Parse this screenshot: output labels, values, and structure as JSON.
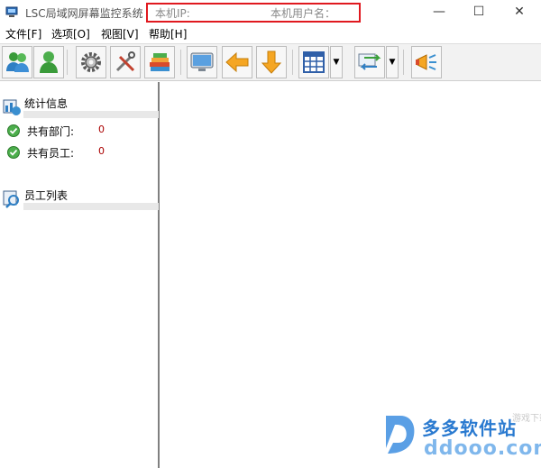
{
  "window": {
    "title": "LSC局域网屏幕监控系统",
    "ip_label": "本机IP:",
    "user_label": "本机用户名：",
    "highlight_color": "#e0191f",
    "minimize_symbol": "—",
    "maximize_symbol": "☐",
    "close_symbol": "✕"
  },
  "menu": {
    "file": "文件[F]",
    "options": "选项[O]",
    "view": "视图[V]",
    "help": "帮助[H]"
  },
  "toolbar": {
    "buttons": [
      {
        "icon": "users-icon"
      },
      {
        "icon": "user-icon"
      },
      {
        "icon": "gear-icon"
      },
      {
        "icon": "tools-icon"
      },
      {
        "icon": "books-icon"
      },
      {
        "icon": "monitor-icon"
      },
      {
        "icon": "arrow-left-icon"
      },
      {
        "icon": "arrow-down-icon"
      },
      {
        "icon": "grid-layout-icon"
      },
      {
        "icon": "transfer-icon"
      },
      {
        "icon": "megaphone-icon"
      }
    ],
    "dropdown_symbol": "▼"
  },
  "sidebar": {
    "stats_title": "统计信息",
    "departments_label": "共有部门:",
    "departments_count": "0",
    "employees_label": "共有员工:",
    "employees_count": "0",
    "employee_list_title": "员工列表"
  },
  "watermark": {
    "name": "多多软件站",
    "domain": "ddooo.com",
    "faint": "游戏下载网"
  }
}
